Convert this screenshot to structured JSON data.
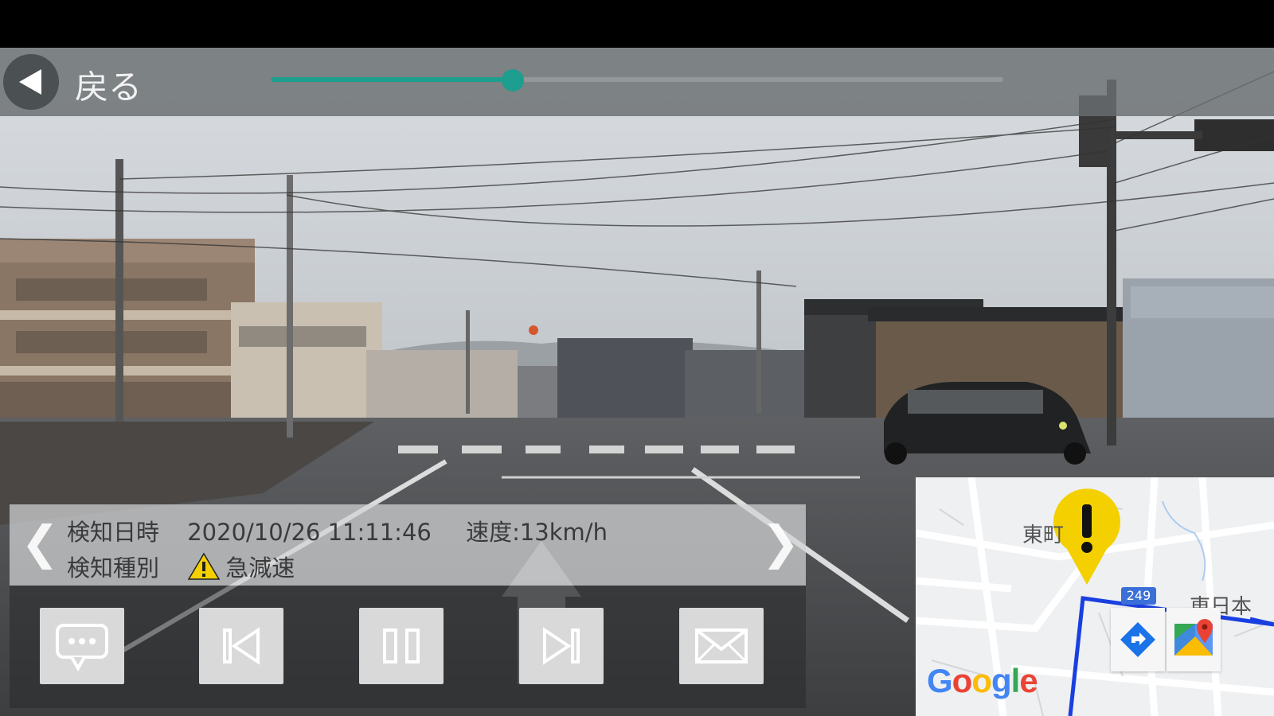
{
  "header": {
    "back_label": "戻る",
    "playback_progress": 0.33
  },
  "info": {
    "time_label": "検知日時",
    "time_value": "2020/10/26 11:11:46",
    "speed_text": "速度:13km/h",
    "type_label": "検知種別",
    "type_value": "急減速",
    "prev_glyph": "❮",
    "next_glyph": "❯"
  },
  "controls": [
    {
      "name": "comment-button",
      "icon": "speech-bubble-icon"
    },
    {
      "name": "previous-button",
      "icon": "skip-previous-icon"
    },
    {
      "name": "pause-button",
      "icon": "pause-icon"
    },
    {
      "name": "next-button",
      "icon": "skip-next-icon"
    },
    {
      "name": "mail-button",
      "icon": "mail-icon"
    }
  ],
  "map": {
    "label_top": "東町",
    "label_right": "東日本",
    "route_number": "249",
    "provider": "Google",
    "directions_icon": "directions-icon",
    "maps_icon": "google-maps-icon"
  },
  "colors": {
    "accent": "#1d9e8f",
    "warning_marker": "#f4d000",
    "route": "#1a3fe0"
  }
}
